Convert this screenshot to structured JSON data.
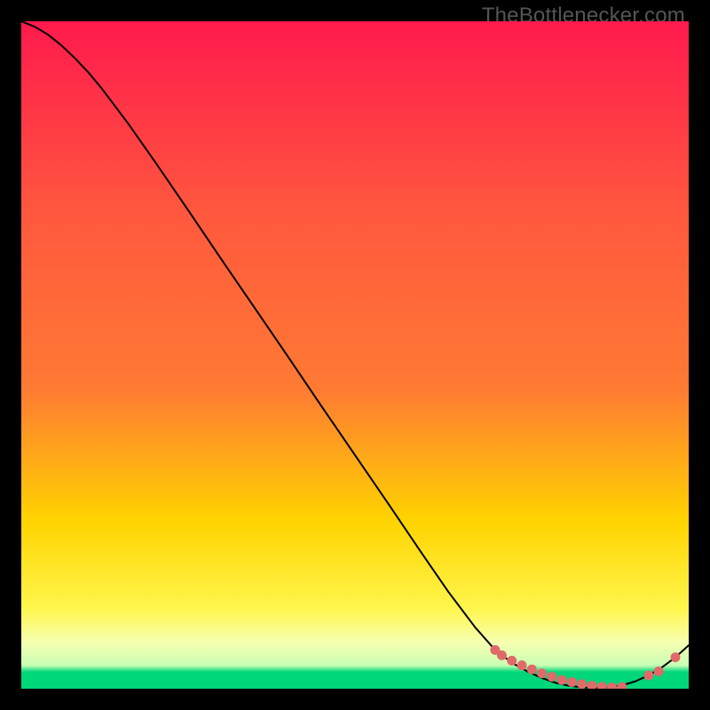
{
  "watermark": "TheBottlenecker.com",
  "chart_data": {
    "type": "line",
    "title": "",
    "xlabel": "",
    "ylabel": "",
    "xlim": [
      0,
      100
    ],
    "ylim": [
      0,
      100
    ],
    "background_gradient": {
      "top": "#ff1a4d",
      "mid_upper": "#ff7a33",
      "mid": "#ffd400",
      "mid_lower": "#fff64d",
      "band": "#f7ffb0",
      "bottom": "#00d67a"
    },
    "series": [
      {
        "name": "curve",
        "type": "line",
        "color": "#000000",
        "x": [
          0,
          2,
          4,
          6,
          8,
          10,
          12,
          16,
          20,
          25,
          30,
          35,
          40,
          45,
          50,
          55,
          60,
          64,
          68,
          71,
          72,
          74,
          76,
          78,
          80,
          82,
          84,
          86,
          88,
          90,
          92,
          94,
          96,
          98,
          100
        ],
        "y": [
          100,
          99.2,
          98.0,
          96.4,
          94.5,
          92.4,
          90.0,
          84.7,
          79.0,
          71.7,
          64.3,
          57.0,
          49.7,
          42.3,
          35.0,
          27.7,
          20.3,
          14.5,
          9.2,
          5.8,
          5.0,
          3.6,
          2.5,
          1.6,
          0.9,
          0.45,
          0.2,
          0.1,
          0.2,
          0.5,
          1.1,
          2.0,
          3.2,
          4.7,
          6.5
        ]
      },
      {
        "name": "markers",
        "type": "scatter",
        "color": "#e06a6a",
        "x": [
          71,
          72,
          73.5,
          75,
          76.5,
          78,
          79.5,
          81,
          82.5,
          84,
          85.5,
          87,
          88.5,
          90,
          94,
          95.5,
          98
        ],
        "y": [
          5.8,
          5.0,
          4.2,
          3.5,
          2.9,
          2.3,
          1.8,
          1.3,
          1.0,
          0.7,
          0.45,
          0.3,
          0.2,
          0.25,
          2.0,
          2.6,
          4.7
        ]
      }
    ]
  }
}
